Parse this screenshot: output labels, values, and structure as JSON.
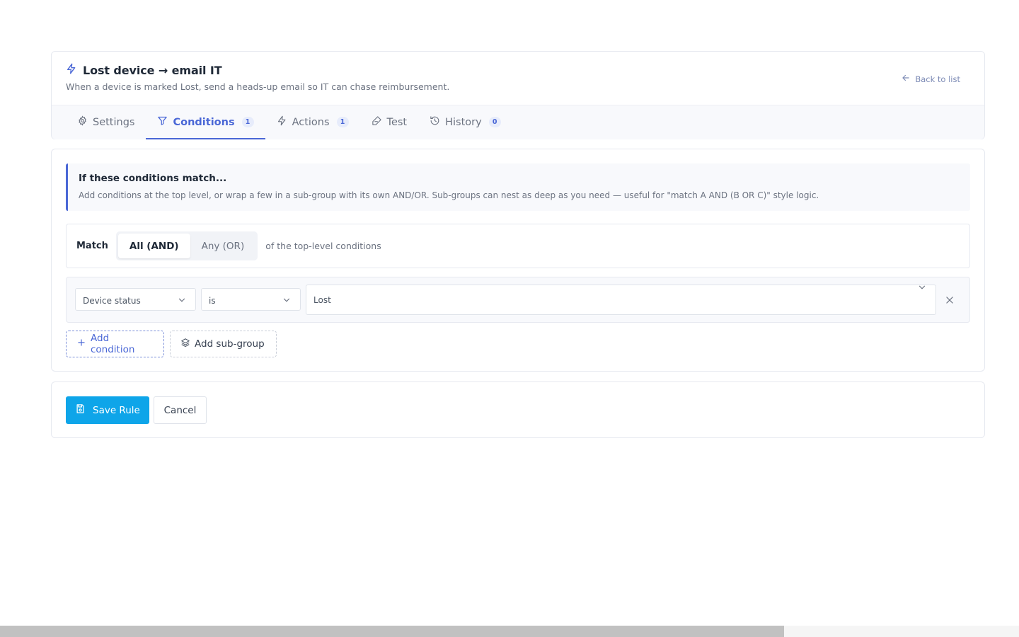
{
  "rule": {
    "title": "Lost device → email IT",
    "subtitle": "When a device is marked Lost, send a heads-up email so IT can chase reimbursement.",
    "back_label": "Back to list"
  },
  "tabs": [
    {
      "label": "Settings",
      "icon": "gear-icon",
      "badge": null,
      "active": false
    },
    {
      "label": "Conditions",
      "icon": "filter-icon",
      "badge": "1",
      "active": true
    },
    {
      "label": "Actions",
      "icon": "bolt-icon",
      "badge": "1",
      "active": false
    },
    {
      "label": "Test",
      "icon": "flask-icon",
      "badge": null,
      "active": false
    },
    {
      "label": "History",
      "icon": "history-icon",
      "badge": "0",
      "active": false
    }
  ],
  "conditions": {
    "info_title": "If these conditions match...",
    "info_text": "Add conditions at the top level, or wrap a few in a sub-group with its own AND/OR. Sub-groups can nest as deep as you need — useful for \"match A AND (B OR C)\" style logic.",
    "match_label": "Match",
    "match_options": [
      "All (AND)",
      "Any (OR)"
    ],
    "match_selected": "All (AND)",
    "match_suffix": "of the top-level conditions",
    "rows": [
      {
        "field": "Device status",
        "operator": "is",
        "value": "Lost"
      }
    ],
    "add_condition_label": "Add condition",
    "add_subgroup_label": "Add sub-group"
  },
  "footer": {
    "save_label": "Save Rule",
    "cancel_label": "Cancel"
  },
  "colors": {
    "accent": "#4a67d6",
    "primary_button": "#0ea5e9"
  }
}
